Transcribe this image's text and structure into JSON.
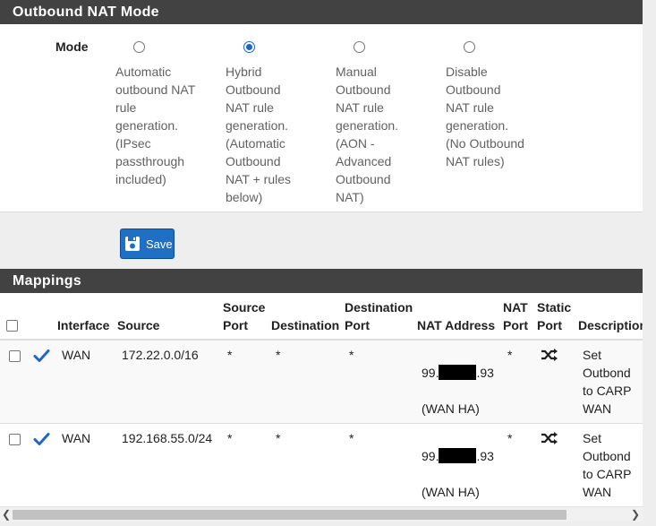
{
  "nat_mode": {
    "heading": "Outbound NAT Mode",
    "mode_label": "Mode",
    "options": [
      {
        "text": "Automatic\noutbound NAT\nrule\ngeneration.\n(IPsec\npassthrough\nincluded)",
        "checked": false
      },
      {
        "text": "Hybrid\nOutbound\nNAT rule\ngeneration.\n(Automatic\nOutbound\nNAT + rules\nbelow)",
        "checked": true
      },
      {
        "text": "Manual\nOutbound\nNAT rule\ngeneration.\n(AON -\nAdvanced\nOutbound\nNAT)",
        "checked": false
      },
      {
        "text": "Disable\nOutbound\nNAT rule\ngeneration.\n(No Outbound\nNAT rules)",
        "checked": false
      }
    ]
  },
  "save_button": {
    "label": "Save"
  },
  "mappings": {
    "heading": "Mappings",
    "columns": {
      "interface": "Interface",
      "source": "Source",
      "source_port": "Source\nPort",
      "destination": "Destination",
      "destination_port": "Destination\nPort",
      "nat_address": "NAT Address",
      "nat_port": "NAT\nPort",
      "static_port": "Static\nPort",
      "description": "Description"
    },
    "rows": [
      {
        "interface": "WAN",
        "source": "172.22.0.0/16",
        "source_port": "*",
        "destination": "*",
        "destination_port": "*",
        "nat_address_prefix": "99.",
        "nat_address_suffix": ".93",
        "nat_address_label": "(WAN HA)",
        "nat_port": "*",
        "description": "Set\nOutbond\nto CARP\nWAN"
      },
      {
        "interface": "WAN",
        "source": "192.168.55.0/24",
        "source_port": "*",
        "destination": "*",
        "destination_port": "*",
        "nat_address_prefix": "99.",
        "nat_address_suffix": ".93",
        "nat_address_label": "(WAN HA)",
        "nat_port": "*",
        "description": "Set\nOutbond\nto CARP\nWAN"
      }
    ]
  },
  "colors": {
    "accent": "#1f6fc5",
    "heading_bg": "#424242",
    "check": "#1e66c9"
  }
}
